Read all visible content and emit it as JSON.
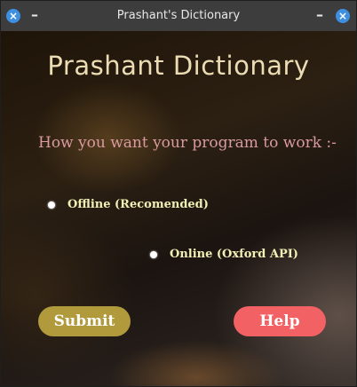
{
  "window": {
    "title": "Prashant's Dictionary",
    "close_glyph": "×",
    "minimize_glyph": "–"
  },
  "app": {
    "title": "Prashant Dictionary",
    "question": "How you want your program to work :-"
  },
  "options": [
    {
      "label": "Offline (Recomended)"
    },
    {
      "label": "Online (Oxford API)"
    }
  ],
  "buttons": {
    "submit": "Submit",
    "help": "Help"
  },
  "colors": {
    "title_text": "#ecdcb4",
    "question_text": "#d99aa0",
    "option_text": "#f3f0b6",
    "submit_bg": "#b09a3b",
    "help_bg": "#f26163",
    "titlebar_button": "#3f8fe0"
  },
  "icons": [
    "close-icon",
    "minimize-icon",
    "radio-icon"
  ]
}
